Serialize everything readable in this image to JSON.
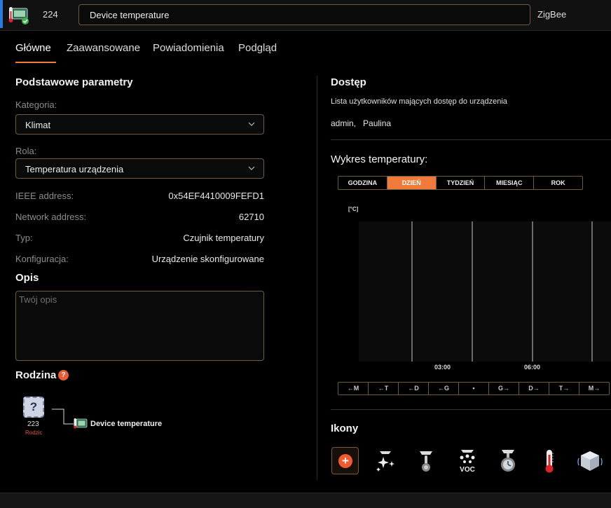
{
  "header": {
    "device_id": "224",
    "device_name": "Device temperature",
    "protocol": "ZigBee"
  },
  "tabs": [
    {
      "label": "Główne",
      "active": true
    },
    {
      "label": "Zaawansowane",
      "active": false
    },
    {
      "label": "Powiadomienia",
      "active": false
    },
    {
      "label": "Podgląd",
      "active": false
    }
  ],
  "basic": {
    "title": "Podstawowe parametry",
    "category_label": "Kategoria:",
    "category_value": "Klimat",
    "role_label": "Rola:",
    "role_value": "Temperatura urządzenia",
    "ieee_label": "IEEE address:",
    "ieee_value": "0x54EF4410009FEFD1",
    "network_label": "Network address:",
    "network_value": "62710",
    "type_label": "Typ:",
    "type_value": "Czujnik temperatury",
    "config_label": "Konfiguracja:",
    "config_value": "Urządzenie skonfigurowane"
  },
  "description": {
    "title": "Opis",
    "placeholder": "Twój opis"
  },
  "family": {
    "title": "Rodzina",
    "help": "?",
    "parent_id": "223",
    "parent_role": "Rodzic",
    "parent_icon": "?",
    "child_name": "Device temperature"
  },
  "access": {
    "title": "Dostęp",
    "description": "Lista użytkowników mających dostęp do urządzenia",
    "users": "admin,   Paulina"
  },
  "chart": {
    "title": "Wykres temperatury:",
    "ranges": [
      {
        "label": "GODZINA",
        "active": false
      },
      {
        "label": "DZIEŃ",
        "active": true
      },
      {
        "label": "TYDZIEŃ",
        "active": false
      },
      {
        "label": "MIESIĄC",
        "active": false
      },
      {
        "label": "ROK",
        "active": false
      }
    ],
    "unit": "[°C]",
    "x_ticks": [
      "03:00",
      "06:00"
    ],
    "nav": [
      "←M",
      "←T",
      "←D",
      "←G",
      "•",
      "G→",
      "D→",
      "T→",
      "M→"
    ]
  },
  "icons": {
    "title": "Ikony",
    "add_label": "+",
    "items": [
      "sparkle-sensor-icon",
      "probe-sensor-icon",
      "voc-sensor-icon",
      "timer-sensor-icon",
      "thermometer-icon",
      "cube-sensor-icon"
    ],
    "voc_text": "VOC"
  },
  "colors": {
    "accent": "#f07a3a",
    "border": "#6e5a3e",
    "alert": "#e85d35"
  }
}
